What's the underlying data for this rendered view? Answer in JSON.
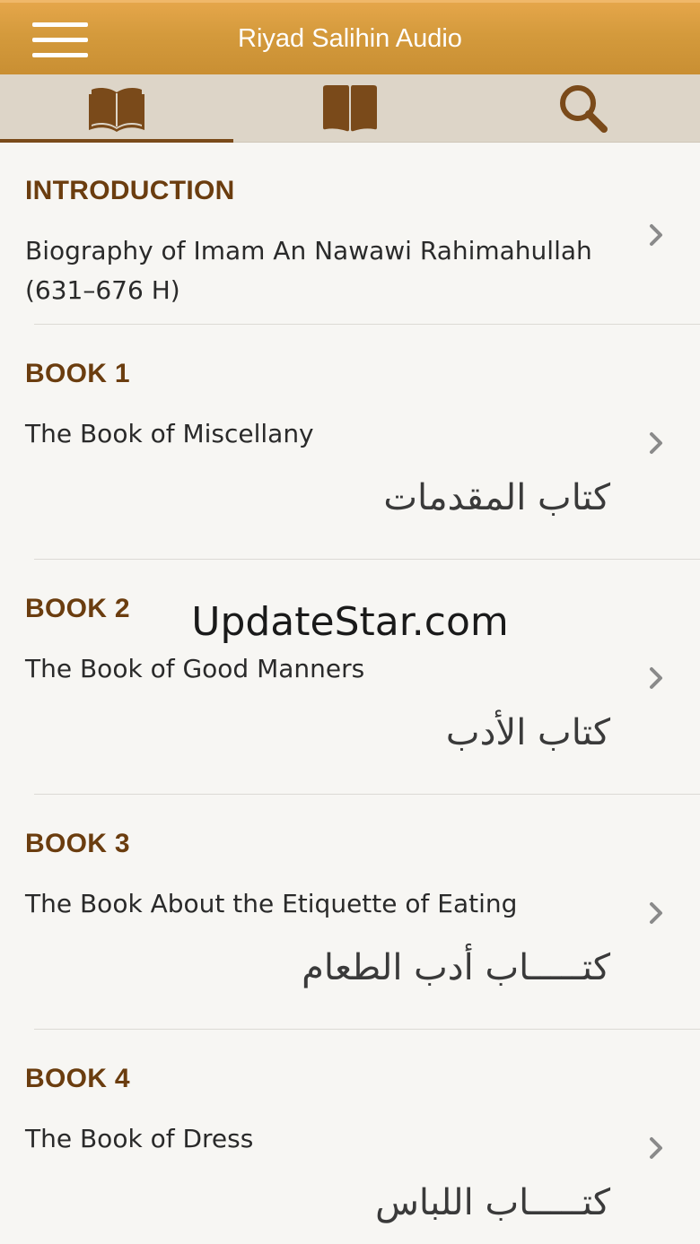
{
  "navbar": {
    "title": "Riyad Salihin Audio"
  },
  "tabs": [
    {
      "name": "contents"
    },
    {
      "name": "bookmarks"
    },
    {
      "name": "search"
    }
  ],
  "rows": [
    {
      "heading": "INTRODUCTION",
      "title": "Biography of Imam An Nawawi Rahimahullah (631–676 H)",
      "arabic": ""
    },
    {
      "heading": "BOOK 1",
      "title": "The Book of Miscellany",
      "arabic": "كتاب المقدمات"
    },
    {
      "heading": "BOOK 2",
      "title": "The Book of Good Manners",
      "arabic": "كتاب الأدب"
    },
    {
      "heading": "BOOK 3",
      "title": "The Book About the Etiquette of Eating",
      "arabic": "كتـــــاب أدب الطعام"
    },
    {
      "heading": "BOOK 4",
      "title": "The Book of Dress",
      "arabic": "كتـــــاب اللباس"
    }
  ],
  "watermark": "UpdateStar.com",
  "colors": {
    "navbar": "#d49a3c",
    "accent": "#6b3d0f",
    "tabbar": "#ddd5c8"
  }
}
